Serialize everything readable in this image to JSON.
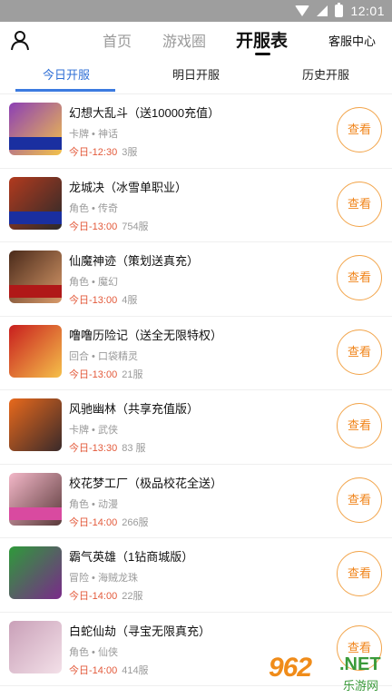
{
  "status_bar": {
    "time": "12:01",
    "icons": [
      "wifi-icon",
      "signal-icon",
      "battery-icon"
    ]
  },
  "header": {
    "nav": [
      "首页",
      "游戏圈",
      "开服表"
    ],
    "active_nav": "开服表",
    "service": "客服中心",
    "user_icon": "user-icon"
  },
  "tabs": {
    "items": [
      "今日开服",
      "明日开服",
      "历史开服"
    ],
    "active": "今日开服"
  },
  "colors": {
    "accent_blue": "#2f6fd6",
    "time_red": "#e35a3b",
    "button_orange": "#f0841a"
  },
  "games": [
    {
      "name": "幻想大乱斗（送10000充值）",
      "meta": "卡牌 • 神话",
      "time": "今日-12:30",
      "servers": "3服",
      "button": "查看",
      "thumb_colors": [
        "#8c3fb5",
        "#f2c24a"
      ]
    },
    {
      "name": "龙城决（冰雪单职业）",
      "meta": "角色 • 传奇",
      "time": "今日-13:00",
      "servers": "754服",
      "button": "查看",
      "thumb_colors": [
        "#b23a1e",
        "#2a2a2a"
      ]
    },
    {
      "name": "仙魔神迹（策划送真充）",
      "meta": "角色 • 魔幻",
      "time": "今日-13:00",
      "servers": "4服",
      "button": "查看",
      "thumb_colors": [
        "#4a2a1a",
        "#d89a6a"
      ]
    },
    {
      "name": "噜噜历险记（送全无限特权）",
      "meta": "回合 • 口袋精灵",
      "time": "今日-13:00",
      "servers": "21服",
      "button": "查看",
      "thumb_colors": [
        "#c81e1e",
        "#f5c04a"
      ]
    },
    {
      "name": "风驰幽林（共享充值版）",
      "meta": "卡牌 • 武侠",
      "time": "今日-13:30",
      "servers": "83 服",
      "button": "查看",
      "thumb_colors": [
        "#e8691c",
        "#3a2a2a"
      ]
    },
    {
      "name": "校花梦工厂（极品校花全送）",
      "meta": "角色 • 动漫",
      "time": "今日-14:00",
      "servers": "266服",
      "button": "查看",
      "thumb_colors": [
        "#f3b7c8",
        "#5a3a3a"
      ]
    },
    {
      "name": "霸气英雄（1钻商城版）",
      "meta": "冒险 • 海贼龙珠",
      "time": "今日-14:00",
      "servers": "22服",
      "button": "查看",
      "thumb_colors": [
        "#2e9a3a",
        "#7a2a8a"
      ]
    },
    {
      "name": "白蛇仙劫（寻宝无限真充）",
      "meta": "角色 • 仙侠",
      "time": "今日-14:00",
      "servers": "414服",
      "button": "查看",
      "thumb_colors": [
        "#c9a0b8",
        "#f3e0e8"
      ]
    }
  ],
  "watermark": {
    "logo": "962",
    "tld": ".NET",
    "sub": "乐游网"
  }
}
